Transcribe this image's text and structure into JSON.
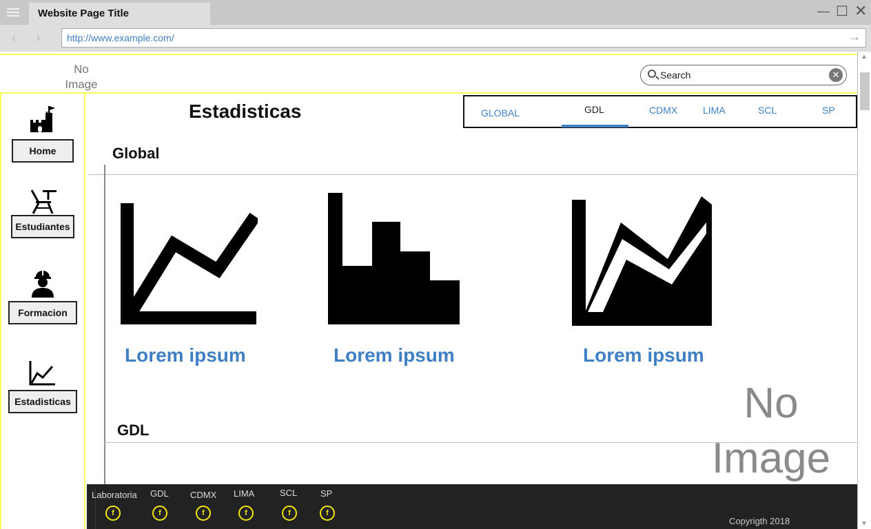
{
  "browser": {
    "tab_title": "Website Page Title",
    "url": "http://www.example.com/"
  },
  "header": {
    "logo_placeholder": "No Image",
    "search": {
      "placeholder": "Search"
    }
  },
  "sidebar": {
    "items": [
      {
        "label": "Home",
        "icon": "castle-icon"
      },
      {
        "label": "Estudiantes",
        "icon": "desk-chair-icon"
      },
      {
        "label": "Formacion",
        "icon": "worker-icon"
      },
      {
        "label": "Estadisticas",
        "icon": "line-chart-icon"
      }
    ]
  },
  "main": {
    "title": "Estadisticas",
    "tabs": [
      {
        "label": "GLOBAL"
      },
      {
        "label": "GDL",
        "active": true
      },
      {
        "label": "CDMX"
      },
      {
        "label": "LIMA"
      },
      {
        "label": "SCL"
      },
      {
        "label": "SP"
      }
    ],
    "sections": [
      {
        "title": "Global",
        "cards": [
          {
            "label": "Lorem ipsum",
            "icon": "line-chart-icon"
          },
          {
            "label": "Lorem ipsum",
            "icon": "step-area-chart-icon"
          },
          {
            "label": "Lorem ipsum",
            "icon": "area-chart-icon"
          }
        ]
      },
      {
        "title": "GDL"
      }
    ],
    "image_placeholder": "No Image"
  },
  "footer": {
    "links": [
      "Laboratoria",
      "GDL",
      "CDMX",
      "LIMA",
      "SCL",
      "SP"
    ],
    "social_icon": "facebook-icon",
    "copyright": "Copyrigth 2018"
  },
  "colors": {
    "accent": "#3f7fc4",
    "highlight_border": "#ffff55",
    "footer_bg": "#222222",
    "social": "#f5e60a"
  }
}
